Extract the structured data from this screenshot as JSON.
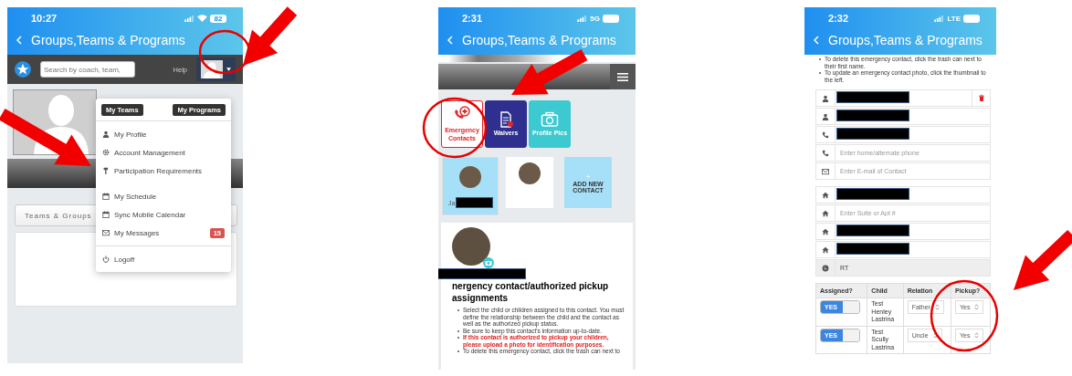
{
  "screens": [
    {
      "kind": "account-menu",
      "status_bar": {
        "time": "10:27",
        "battery": "82"
      },
      "title": "Groups,Teams & Programs",
      "search": {
        "placeholder": "Search by coach, team,"
      },
      "help": "Help",
      "menu": {
        "expanded": true,
        "buttons": [
          "My Teams",
          "My Programs"
        ],
        "sections": [
          {
            "items": [
              {
                "label": "My Profile"
              },
              {
                "label": "Account Management"
              },
              {
                "label": "Participation Requirements"
              }
            ]
          },
          {
            "items": [
              {
                "label": "My Schedule"
              },
              {
                "label": "Sync Mobile Calendar"
              },
              {
                "label": "My Messages",
                "badge": "15"
              }
            ]
          },
          {
            "items": [
              {
                "label": "Logoff"
              }
            ]
          }
        ]
      },
      "tab": "Teams & Groups"
    },
    {
      "kind": "emergency-contacts",
      "status_bar": {
        "time": "2:31",
        "network": "5G"
      },
      "title": "Groups,Teams & Programs",
      "tiles": [
        {
          "label": "Emergency Contacts",
          "selected": true,
          "color": "#e0262b"
        },
        {
          "label": "Waivers",
          "selected": false,
          "color": "#2e2f8f"
        },
        {
          "label": "Profile Pics",
          "selected": false,
          "color": "#3cc9cf"
        }
      ],
      "contacts": [
        {
          "kind": "contact",
          "name": "Ja",
          "selected": true
        },
        {
          "kind": "contact",
          "selected": false
        },
        {
          "kind": "add",
          "plus": "+",
          "label": "ADD NEW CONTACT"
        }
      ],
      "heading": "nergency contact/authorized pickup assignments",
      "bullets": [
        {
          "kind": "note",
          "text": "Select the child or children assigned to this contact. You must define the relationship between the child and the contact as well as the authorized pickup status."
        },
        {
          "kind": "note",
          "text": "Be sure to keep this contact's information up-to-date."
        },
        {
          "kind": "warning",
          "text": "If this contact is authorized to pickup your children, please upload a photo for identification purposes."
        },
        {
          "kind": "note",
          "text": "To delete this emergency contact, click the trash can next to"
        }
      ]
    },
    {
      "kind": "contact-form",
      "status_bar": {
        "time": "2:32",
        "network": "LTE"
      },
      "title": "Groups,Teams & Programs",
      "bullets": [
        {
          "kind": "note",
          "text": "To delete this emergency contact, click the trash can next to their first name."
        },
        {
          "kind": "note",
          "text": "To update an emergency contact photo, click the thumbnail to the left."
        }
      ],
      "field_groups": [
        {
          "fields": [
            {
              "kind": "person",
              "redacted": true,
              "deletable": true
            },
            {
              "kind": "person",
              "redacted": true
            },
            {
              "kind": "phone",
              "redacted": true
            },
            {
              "kind": "phone",
              "placeholder": "Enter home/alternate phone"
            },
            {
              "kind": "email",
              "placeholder": "Enter E-mail of Contact"
            }
          ]
        },
        {
          "fields": [
            {
              "kind": "home",
              "redacted": true
            },
            {
              "kind": "home",
              "placeholder": "Enter Suite or Apt #"
            },
            {
              "kind": "home",
              "redacted": true
            },
            {
              "kind": "home",
              "redacted": true
            },
            {
              "kind": "globe",
              "value": "RT",
              "disabled": true
            }
          ]
        }
      ],
      "table": {
        "columns": [
          "Assigned?",
          "Child",
          "Relation",
          "Pickup?"
        ],
        "rows": [
          {
            "assigned": {
              "on": true,
              "label": "YES"
            },
            "child": "Test Henley Lastrina",
            "relation": "Father",
            "pickup": "Yes"
          },
          {
            "assigned": {
              "on": true,
              "label": "YES"
            },
            "child": "Test Scully Lastrina",
            "relation": "Uncle",
            "pickup": "Yes"
          }
        ]
      }
    }
  ]
}
